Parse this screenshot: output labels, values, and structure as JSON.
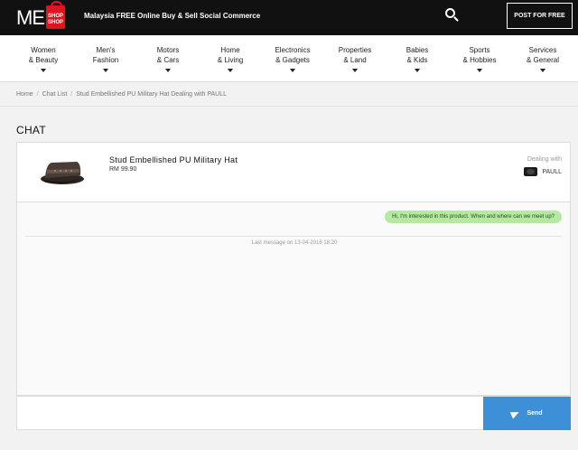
{
  "header": {
    "logo": {
      "text": "ME",
      "bag_line1": "SHOP",
      "bag_line2": "SHOP",
      "color": "#e3131b"
    },
    "tagline": "Malaysia FREE Online Buy & Sell Social Commerce",
    "search_icon": "search-icon",
    "post_button": "POST FOR FREE"
  },
  "categories": [
    {
      "line1": "Women",
      "line2": "& Beauty"
    },
    {
      "line1": "Men's",
      "line2": "Fashion"
    },
    {
      "line1": "Motors",
      "line2": "& Cars"
    },
    {
      "line1": "Home",
      "line2": "& Living"
    },
    {
      "line1": "Electronics",
      "line2": "& Gadgets"
    },
    {
      "line1": "Properties",
      "line2": "& Land"
    },
    {
      "line1": "Babies",
      "line2": "& Kids"
    },
    {
      "line1": "Sports",
      "line2": "& Hobbies"
    },
    {
      "line1": "Services",
      "line2": "& General"
    }
  ],
  "breadcrumb": {
    "items": [
      "Home",
      "Chat List",
      "Stud Embellished PU Military Hat Dealing with PAULL"
    ]
  },
  "page_title": "CHAT",
  "product": {
    "name": "Stud Embellished PU Military Hat",
    "price": "RM 99.90",
    "dealing_label": "Dealing with",
    "dealer_name": "PAULL"
  },
  "chat": {
    "messages": [
      {
        "text": "Hi, I'm interested in this product. When and where can we meet up?",
        "color": "#b5e8a0"
      }
    ],
    "last_message": "Last message on 13-04-2016 18:20"
  },
  "composer": {
    "placeholder": "",
    "send_label": "Send",
    "send_color": "#3d8fd6"
  }
}
